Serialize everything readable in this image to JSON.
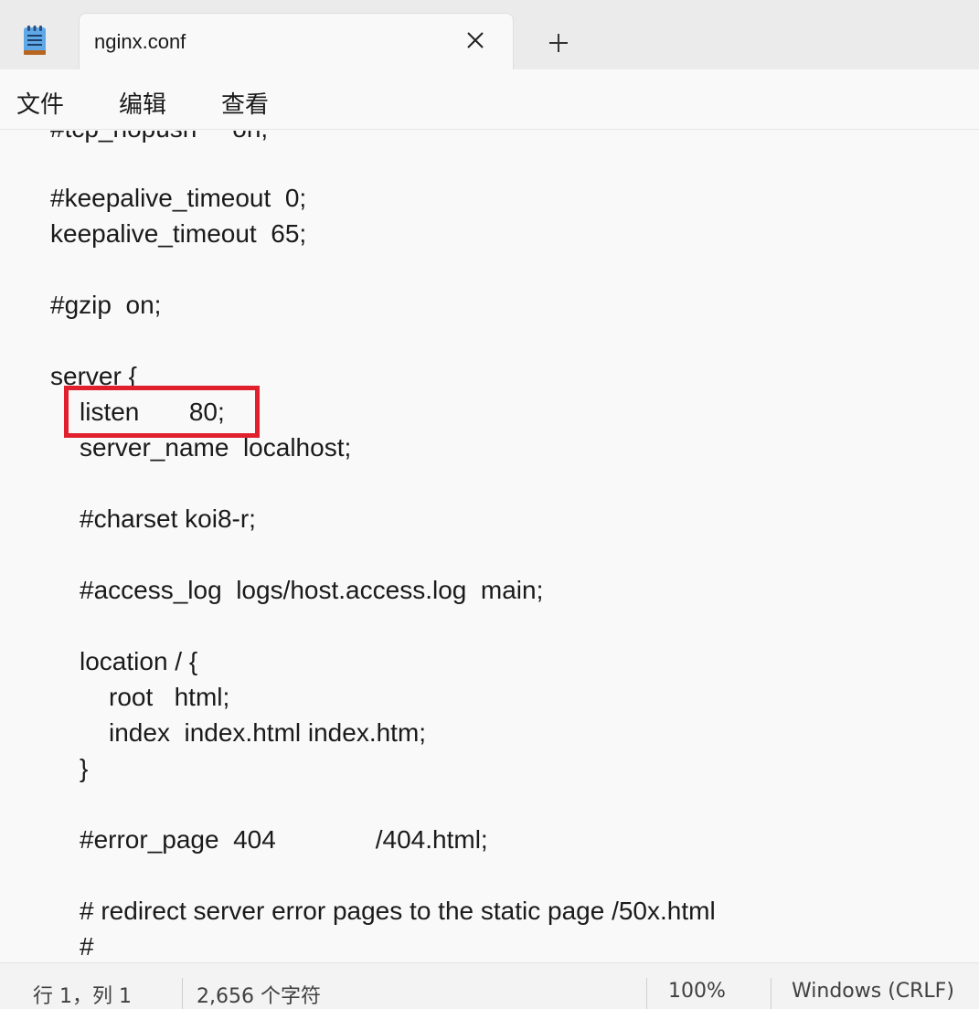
{
  "tab": {
    "title": "nginx.conf",
    "close_icon": "close-icon",
    "new_tab_icon": "plus-icon",
    "app_icon": "notepad-icon"
  },
  "menu": {
    "file": "文件",
    "edit": "编辑",
    "view": "查看"
  },
  "editor": {
    "lines": [
      "#tcp_nopush     on;",
      "",
      "#keepalive_timeout  0;",
      "keepalive_timeout  65;",
      "",
      "#gzip  on;",
      "",
      "server {",
      "listen       80;",
      "server_name  localhost;",
      "",
      "#charset koi8-r;",
      "",
      "#access_log  logs/host.access.log  main;",
      "",
      "location / {",
      "root   html;",
      "index  index.html index.htm;",
      "}",
      "",
      "#error_page  404              /404.html;",
      "",
      "# redirect server error pages to the static page /50x.html",
      "#"
    ],
    "highlight_color": "#e0202c"
  },
  "status": {
    "position": "行 1，列 1",
    "char_count": "2,656 个字符",
    "zoom": "100%",
    "line_ending": "Windows (CRLF)"
  }
}
